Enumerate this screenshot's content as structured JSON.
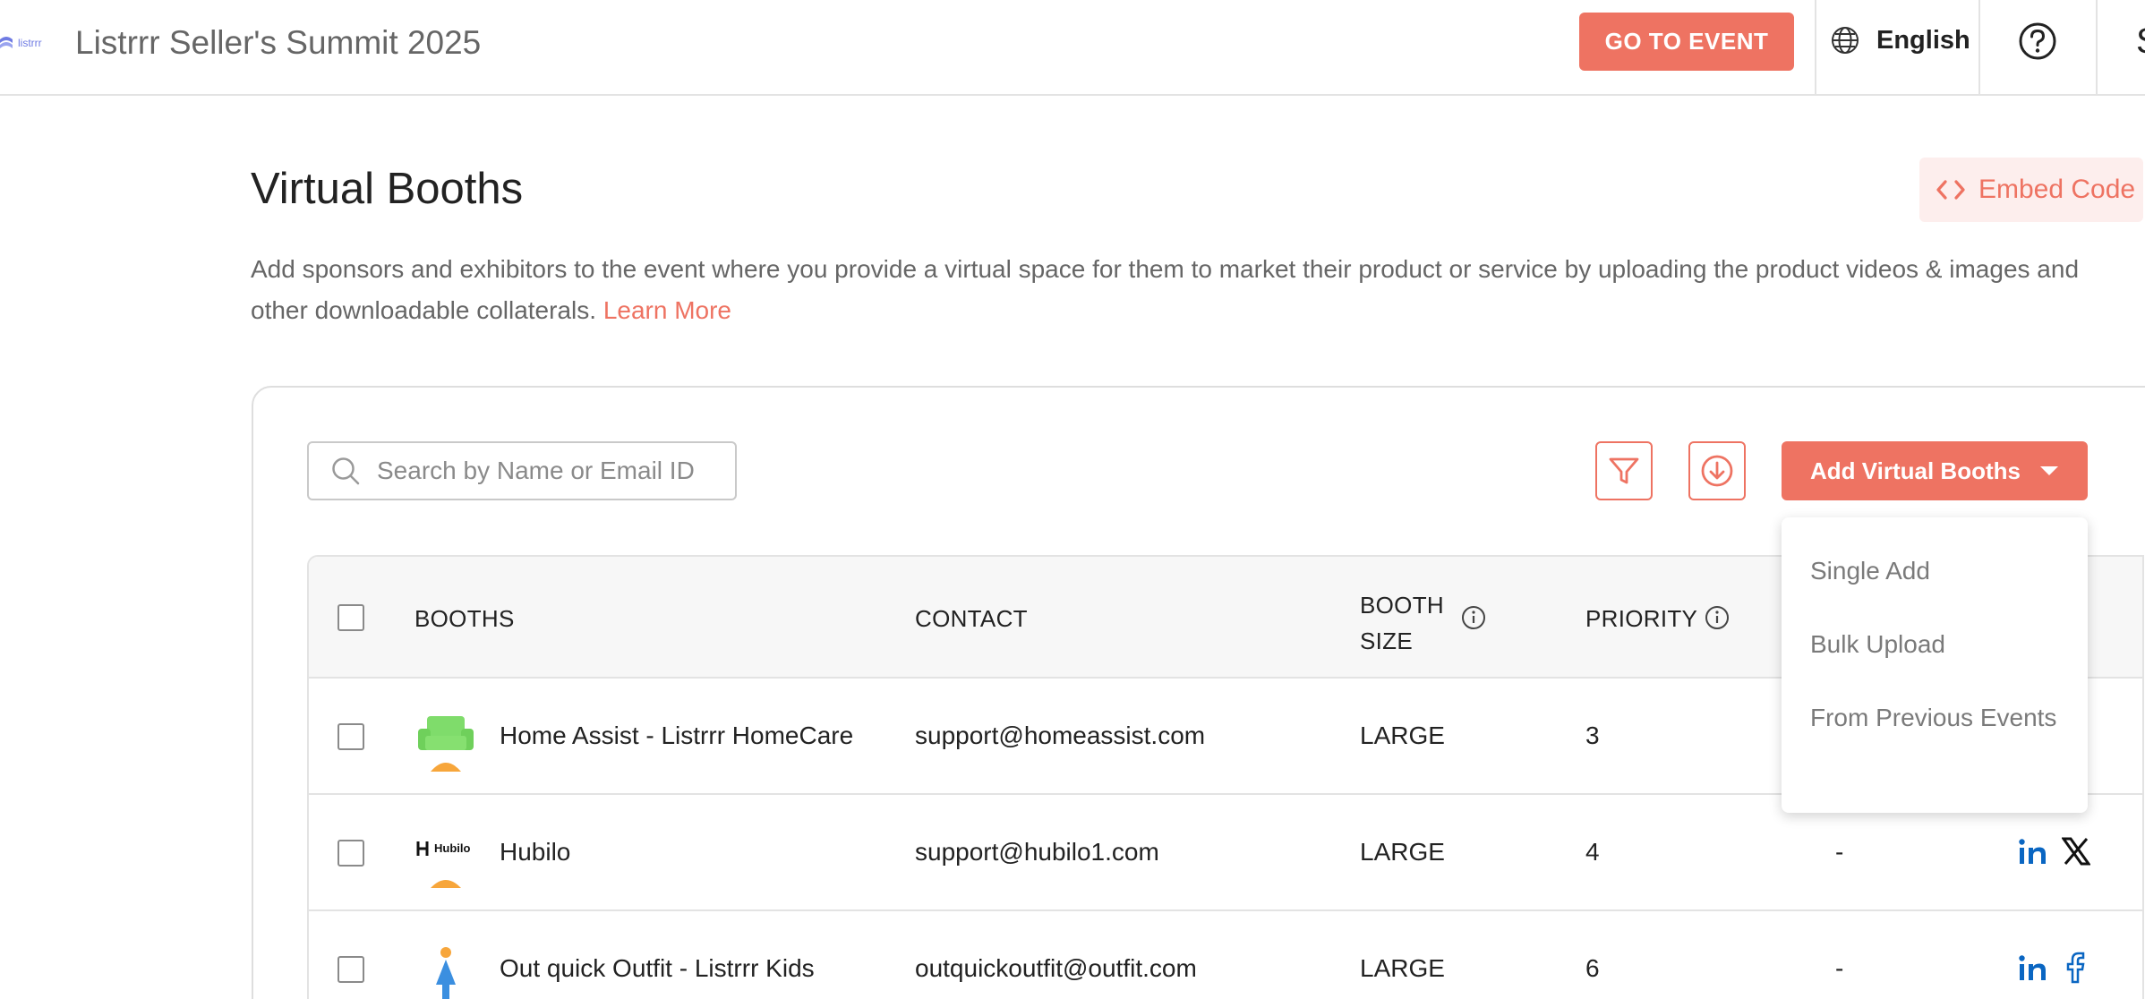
{
  "header": {
    "logo_text": "listrrr",
    "event_title": "Listrrr Seller's Summit 2025",
    "go_to_event_label": "GO TO EVENT",
    "language_label": "English",
    "profile_initial": "S"
  },
  "page": {
    "title": "Virtual Booths",
    "embed_label": "Embed Code",
    "description": "Add sponsors and exhibitors to the event where you provide a virtual space for them to market their product or service by uploading the product videos & images and other downloadable collaterals.",
    "learn_more": "Learn More"
  },
  "toolbar": {
    "search_placeholder": "Search by Name or Email ID",
    "add_label": "Add Virtual Booths"
  },
  "dropdown": {
    "items": [
      "Single Add",
      "Bulk Upload",
      "From Previous Events"
    ]
  },
  "table": {
    "headers": {
      "booths": "BOOTHS",
      "contact": "CONTACT",
      "booth_size_1": "BOOTH",
      "booth_size_2": "SIZE",
      "priority": "PRIORITY"
    },
    "rows": [
      {
        "name": "Home Assist - Listrrr HomeCare",
        "contact": "support@homeassist.com",
        "size": "LARGE",
        "priority": "3",
        "extra": ""
      },
      {
        "name": "Hubilo",
        "contact": "support@hubilo1.com",
        "size": "LARGE",
        "priority": "4",
        "extra": "-",
        "logo_text": "Hubilo"
      },
      {
        "name": "Out quick Outfit - Listrrr Kids",
        "contact": "outquickoutfit@outfit.com",
        "size": "LARGE",
        "priority": "6",
        "extra": "-"
      }
    ]
  },
  "colors": {
    "accent": "#ee7362",
    "accent_light": "#fdeeed",
    "linkedin": "#0a66c2"
  }
}
